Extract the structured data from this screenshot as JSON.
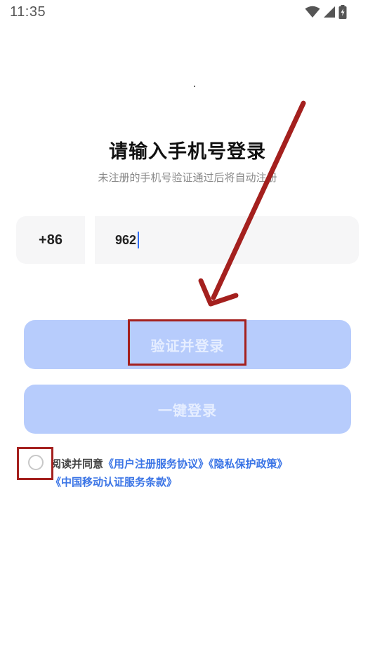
{
  "status_bar": {
    "time": "11:35",
    "icons": [
      "wifi-icon",
      "signal-icon",
      "battery-charging-icon"
    ]
  },
  "login": {
    "title": "请输入手机号登录",
    "subtitle": "未注册的手机号验证通过后将自动注册",
    "country_code": "+86",
    "phone_value": "962",
    "verify_button_label": "验证并登录",
    "onekey_button_label": "一键登录"
  },
  "agreement": {
    "prefix": "阅读并同意",
    "links": [
      "《用户注册服务协议》",
      "《隐私保护政策》",
      "《中国移动认证服务条款》"
    ],
    "checked": false
  },
  "colors": {
    "button_bg": "#b7ccfc",
    "button_text": "#e6eeff",
    "link": "#3a74e6",
    "annotation": "#a4201e",
    "input_bg": "#f6f6f7",
    "caret": "#2f6df6"
  }
}
